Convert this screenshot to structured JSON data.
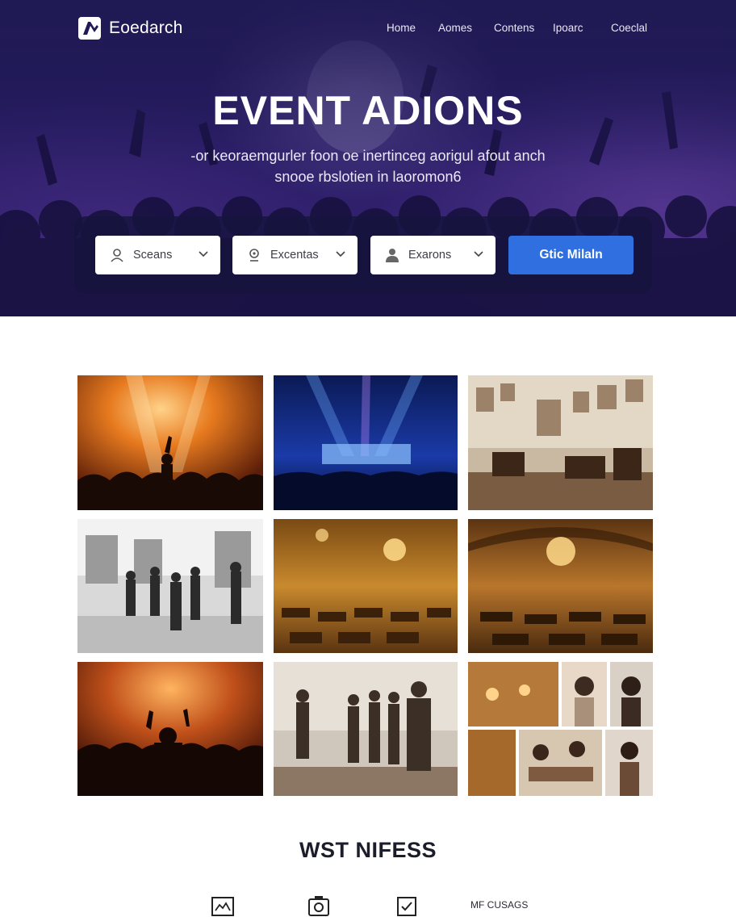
{
  "header": {
    "logo_text": "Eoedarch",
    "nav": [
      "Home",
      "Aomes",
      "Contens",
      "Ipoarc",
      "Coeclal"
    ]
  },
  "hero": {
    "title": "EVENT ADIONS",
    "subtitle_line1": "-or keoraemgurler foon oe inertinceg aorigul afout anch",
    "subtitle_line2": "snooe rbslotien in laoromon6",
    "filters": [
      {
        "label": "Sceans",
        "icon": "user-icon"
      },
      {
        "label": "Excentas",
        "icon": "location-pin-icon"
      },
      {
        "label": "Exarons",
        "icon": "person-icon"
      }
    ],
    "cta_label": "Gtic Milaln"
  },
  "gallery": {
    "tiles": [
      "concert-orange-stage-photo",
      "concert-blue-stage-photo",
      "vintage-lounge-photo",
      "gallery-people-photo",
      "golden-ballroom-photo",
      "chandelier-hall-photo",
      "concert-crowd-photo",
      "fashion-group-photo",
      "collage-photo"
    ]
  },
  "section": {
    "title": "WST NIFESS",
    "feature_label": "MF CUSAGS",
    "feature_icons": [
      "image-frame-icon",
      "camera-icon",
      "checklist-icon"
    ]
  },
  "colors": {
    "hero_bg": "#2a1d66",
    "accent": "#2f6fe0",
    "heading": "#1c1d2b"
  }
}
